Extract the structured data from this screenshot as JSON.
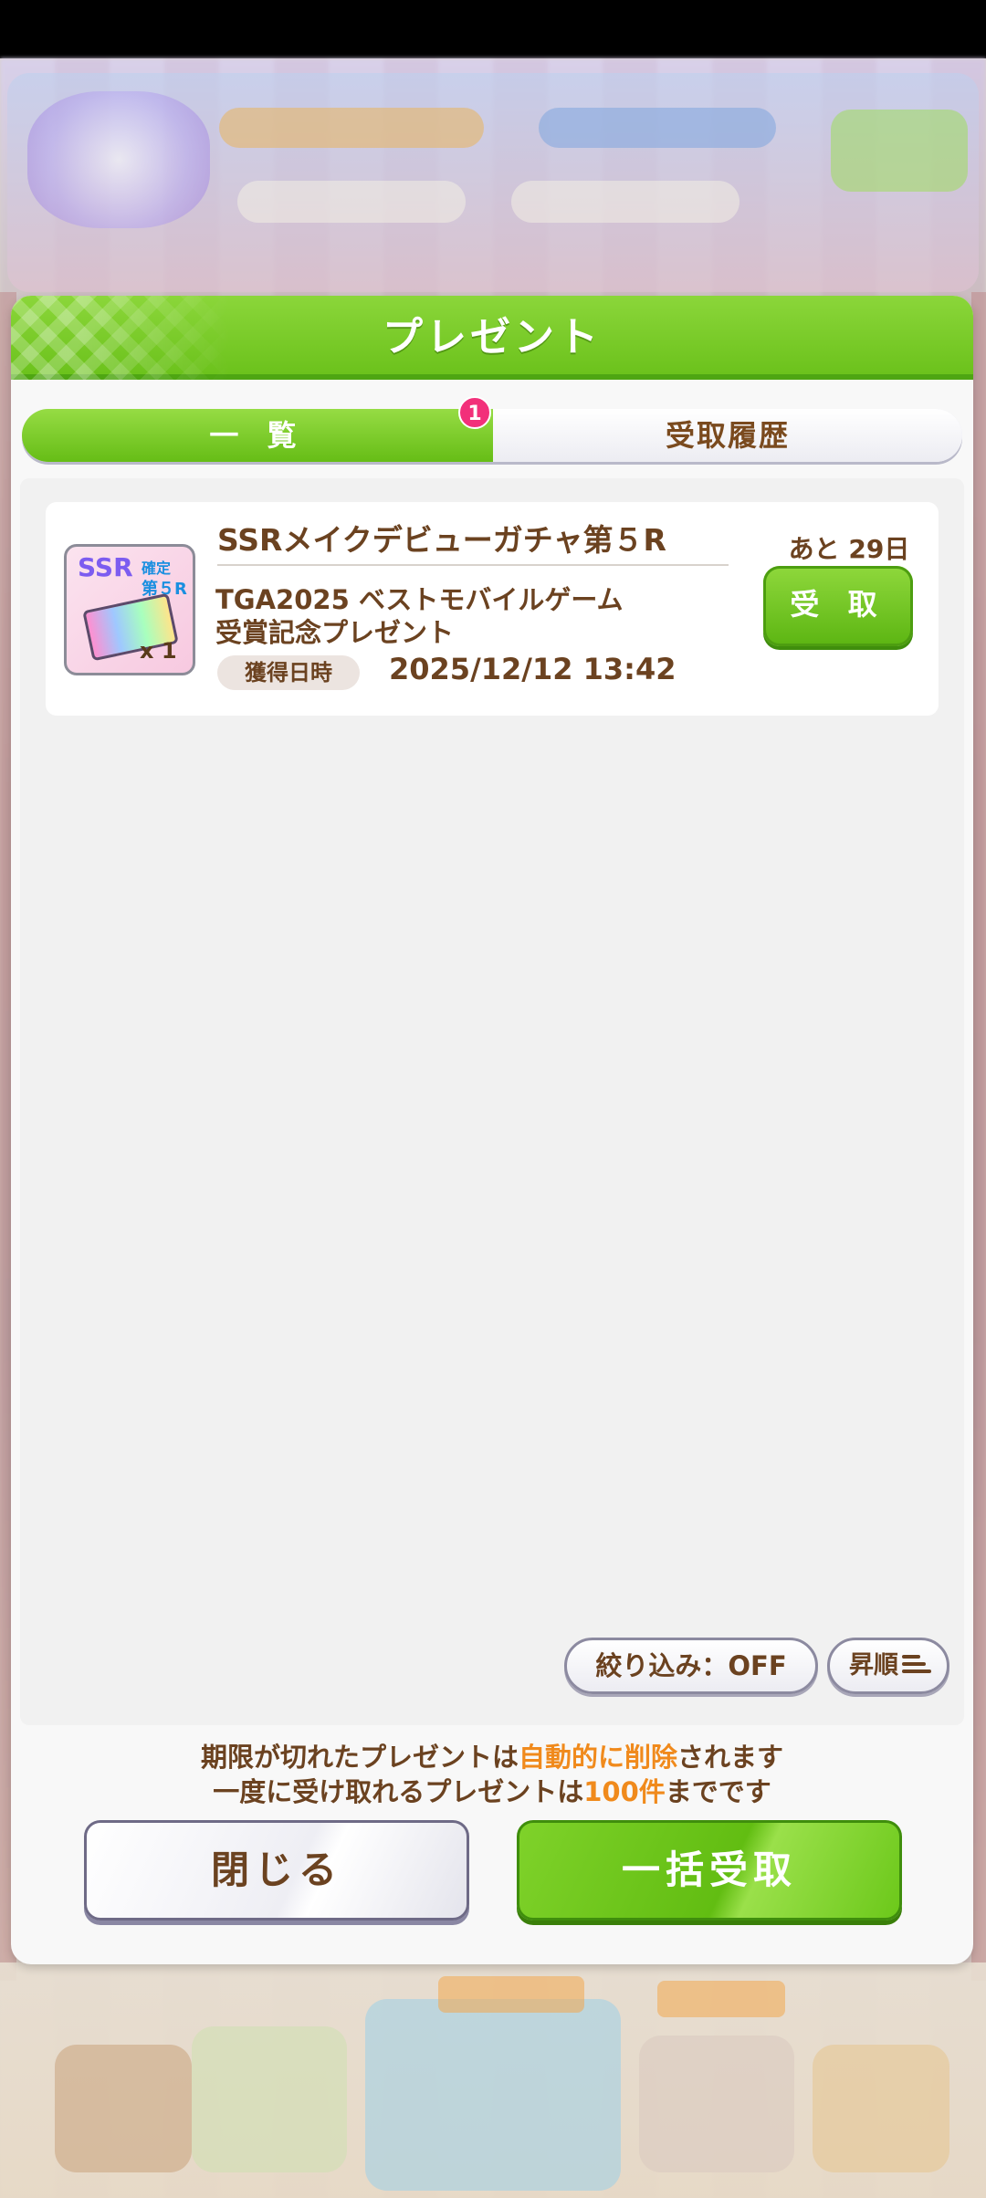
{
  "dialog": {
    "title": "プレゼント"
  },
  "tabs": [
    {
      "label": "一 覧",
      "active": true,
      "badge": "1"
    },
    {
      "label": "受取履歴",
      "active": false
    }
  ],
  "items": [
    {
      "icon": {
        "name": "ssr-gacha-ticket-icon",
        "badge_text": "SSR",
        "badge_sub1": "確定",
        "badge_sub2": "第５R",
        "quantity": "x 1"
      },
      "title": "SSRメイクデビューガチャ第５R",
      "description_line1": "TGA2025 ベストモバイルゲーム",
      "description_line2": "受賞記念プレゼント",
      "acquired_label": "獲得日時",
      "acquired_date": "2025/12/12 13:42",
      "remaining": "あと 29日",
      "receive_label": "受 取"
    }
  ],
  "filter": {
    "label": "絞り込み：OFF"
  },
  "sort": {
    "label": "昇順",
    "icon": "sort-lines-icon"
  },
  "notice": {
    "line1_part1": "期限が切れたプレゼントは",
    "line1_highlight": "自動的に削除",
    "line1_part2": "されます",
    "line2_part1": "一度に受け取れるプレゼントは",
    "line2_highlight": "100件",
    "line2_part2": "までです"
  },
  "buttons": {
    "close_label": "閉じる",
    "bulk_receive_label": "一括受取"
  },
  "colors": {
    "accent_green": "#6cc21c",
    "text_brown": "#6b4220",
    "highlight_orange": "#f08a1c",
    "badge_pink": "#f2307a"
  }
}
